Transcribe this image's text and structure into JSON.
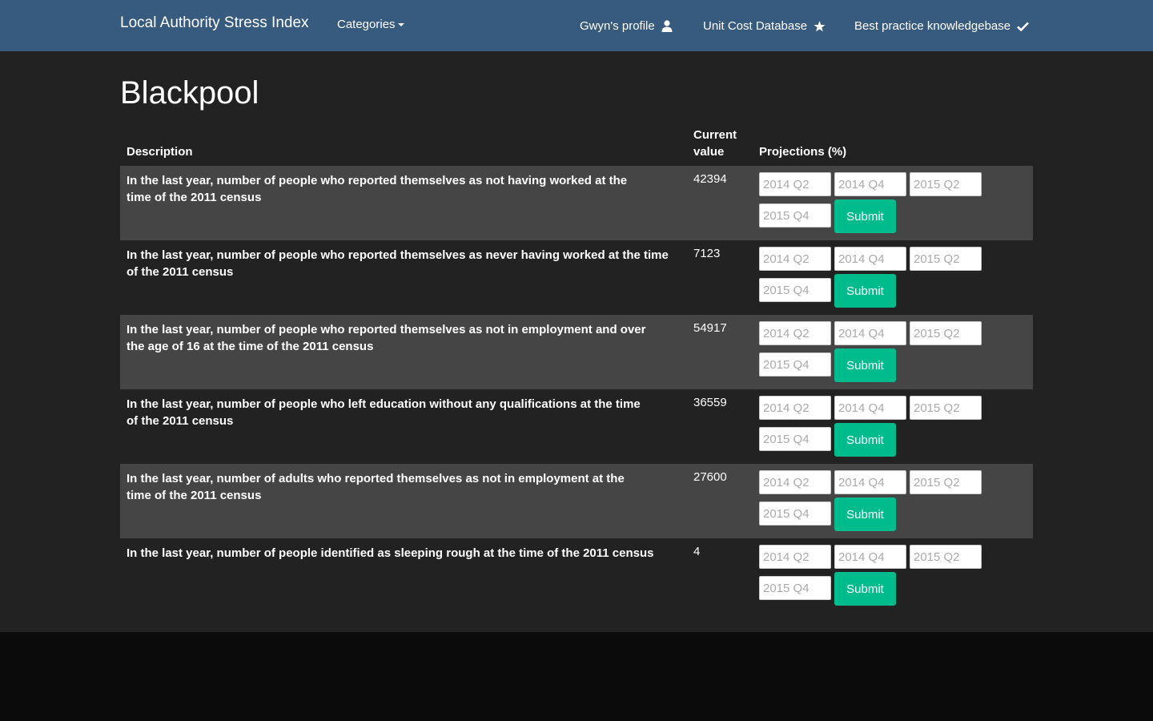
{
  "navbar": {
    "brand": "Local Authority Stress Index",
    "categories": "Categories",
    "profile": "Gwyn's profile",
    "unit_cost": "Unit Cost Database",
    "best_practice": "Best practice knowledgebase"
  },
  "page": {
    "title": "Blackpool"
  },
  "table": {
    "headers": {
      "description": "Description",
      "current_value": "Current value",
      "projections": "Projections (%)"
    },
    "placeholders": [
      "2014 Q2",
      "2014 Q4",
      "2015 Q2",
      "2015 Q4"
    ],
    "submit_label": "Submit",
    "rows": [
      {
        "description": "In the last year, number of people who reported themselves as not having worked at the time of the 2011 census",
        "current_value": "42394"
      },
      {
        "description": "In the last year, number of people who reported themselves as never having worked at the time of the 2011 census",
        "current_value": "7123"
      },
      {
        "description": "In the last year, number of people who reported themselves as not in employment and over the age of 16 at the time of the 2011 census",
        "current_value": "54917"
      },
      {
        "description": "In the last year, number of people who left education without any qualifications at the time of the 2011 census",
        "current_value": "36559"
      },
      {
        "description": "In the last year, number of adults who reported themselves as not in employment at the time of the 2011 census",
        "current_value": "27600"
      },
      {
        "description": "In the last year, number of people identified as sleeping rough at the time of the 2011 census",
        "current_value": "4"
      }
    ]
  }
}
